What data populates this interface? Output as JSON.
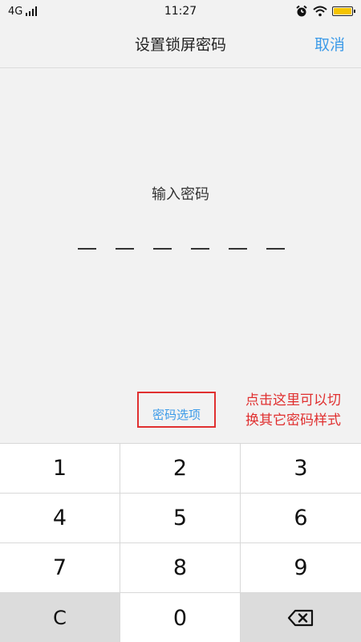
{
  "status_bar": {
    "network": "4G",
    "time": "11:27",
    "battery_level": 1.0,
    "battery_color": "#f5c400",
    "icons": [
      "signal-icon",
      "alarm-icon",
      "wifi-icon",
      "battery-icon"
    ]
  },
  "nav": {
    "title": "设置锁屏密码",
    "cancel_label": "取消"
  },
  "prompt": {
    "label": "输入密码",
    "pin_length": 6
  },
  "options": {
    "link_label": "密码选项"
  },
  "annotation": {
    "line1": "点击这里可以切",
    "line2": "换其它密码样式"
  },
  "keypad": {
    "keys": [
      "1",
      "2",
      "3",
      "4",
      "5",
      "6",
      "7",
      "8",
      "9",
      "C",
      "0"
    ],
    "backspace_icon": "backspace-icon"
  },
  "colors": {
    "accent": "#3d9be8",
    "annotation": "#e03030"
  }
}
